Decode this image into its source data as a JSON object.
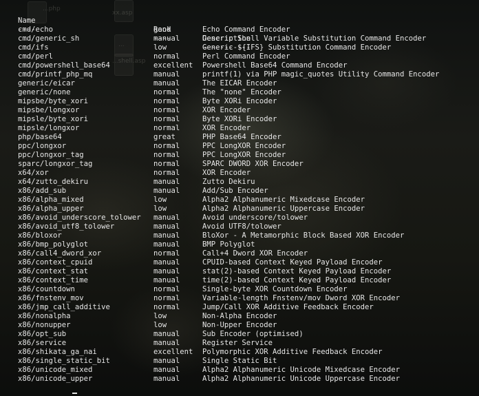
{
  "desktop": {
    "icon_labels": [
      "...php",
      "xx.asp",
      "...",
      "...shell.asp"
    ]
  },
  "terminal": {
    "header": {
      "name": "Name",
      "rank": "Rank",
      "description": "Description"
    },
    "separator": {
      "name": "----",
      "rank": "----",
      "description": "-----------"
    },
    "rows": [
      {
        "name": "cmd/echo",
        "rank": "good",
        "description": "Echo Command Encoder"
      },
      {
        "name": "cmd/generic_sh",
        "rank": "manual",
        "description": "Generic Shell Variable Substitution Command Encoder"
      },
      {
        "name": "cmd/ifs",
        "rank": "low",
        "description": "Generic ${IFS} Substitution Command Encoder"
      },
      {
        "name": "cmd/perl",
        "rank": "normal",
        "description": "Perl Command Encoder"
      },
      {
        "name": "cmd/powershell_base64",
        "rank": "excellent",
        "description": "Powershell Base64 Command Encoder"
      },
      {
        "name": "cmd/printf_php_mq",
        "rank": "manual",
        "description": "printf(1) via PHP magic_quotes Utility Command Encoder"
      },
      {
        "name": "generic/eicar",
        "rank": "manual",
        "description": "The EICAR Encoder"
      },
      {
        "name": "generic/none",
        "rank": "normal",
        "description": "The \"none\" Encoder"
      },
      {
        "name": "mipsbe/byte_xori",
        "rank": "normal",
        "description": "Byte XORi Encoder"
      },
      {
        "name": "mipsbe/longxor",
        "rank": "normal",
        "description": "XOR Encoder"
      },
      {
        "name": "mipsle/byte_xori",
        "rank": "normal",
        "description": "Byte XORi Encoder"
      },
      {
        "name": "mipsle/longxor",
        "rank": "normal",
        "description": "XOR Encoder"
      },
      {
        "name": "php/base64",
        "rank": "great",
        "description": "PHP Base64 Encoder"
      },
      {
        "name": "ppc/longxor",
        "rank": "normal",
        "description": "PPC LongXOR Encoder"
      },
      {
        "name": "ppc/longxor_tag",
        "rank": "normal",
        "description": "PPC LongXOR Encoder"
      },
      {
        "name": "sparc/longxor_tag",
        "rank": "normal",
        "description": "SPARC DWORD XOR Encoder"
      },
      {
        "name": "x64/xor",
        "rank": "normal",
        "description": "XOR Encoder"
      },
      {
        "name": "x64/zutto_dekiru",
        "rank": "manual",
        "description": "Zutto Dekiru"
      },
      {
        "name": "x86/add_sub",
        "rank": "manual",
        "description": "Add/Sub Encoder"
      },
      {
        "name": "x86/alpha_mixed",
        "rank": "low",
        "description": "Alpha2 Alphanumeric Mixedcase Encoder"
      },
      {
        "name": "x86/alpha_upper",
        "rank": "low",
        "description": "Alpha2 Alphanumeric Uppercase Encoder"
      },
      {
        "name": "x86/avoid_underscore_tolower",
        "rank": "manual",
        "description": "Avoid underscore/tolower"
      },
      {
        "name": "x86/avoid_utf8_tolower",
        "rank": "manual",
        "description": "Avoid UTF8/tolower"
      },
      {
        "name": "x86/bloxor",
        "rank": "manual",
        "description": "BloXor - A Metamorphic Block Based XOR Encoder"
      },
      {
        "name": "x86/bmp_polyglot",
        "rank": "manual",
        "description": "BMP Polyglot"
      },
      {
        "name": "x86/call4_dword_xor",
        "rank": "normal",
        "description": "Call+4 Dword XOR Encoder"
      },
      {
        "name": "x86/context_cpuid",
        "rank": "manual",
        "description": "CPUID-based Context Keyed Payload Encoder"
      },
      {
        "name": "x86/context_stat",
        "rank": "manual",
        "description": "stat(2)-based Context Keyed Payload Encoder"
      },
      {
        "name": "x86/context_time",
        "rank": "manual",
        "description": "time(2)-based Context Keyed Payload Encoder"
      },
      {
        "name": "x86/countdown",
        "rank": "normal",
        "description": "Single-byte XOR Countdown Encoder"
      },
      {
        "name": "x86/fnstenv_mov",
        "rank": "normal",
        "description": "Variable-length Fnstenv/mov Dword XOR Encoder"
      },
      {
        "name": "x86/jmp_call_additive",
        "rank": "normal",
        "description": "Jump/Call XOR Additive Feedback Encoder"
      },
      {
        "name": "x86/nonalpha",
        "rank": "low",
        "description": "Non-Alpha Encoder"
      },
      {
        "name": "x86/nonupper",
        "rank": "low",
        "description": "Non-Upper Encoder"
      },
      {
        "name": "x86/opt_sub",
        "rank": "manual",
        "description": "Sub Encoder (optimised)"
      },
      {
        "name": "x86/service",
        "rank": "manual",
        "description": "Register Service"
      },
      {
        "name": "x86/shikata_ga_nai",
        "rank": "excellent",
        "description": "Polymorphic XOR Additive Feedback Encoder"
      },
      {
        "name": "x86/single_static_bit",
        "rank": "manual",
        "description": "Single Static Bit"
      },
      {
        "name": "x86/unicode_mixed",
        "rank": "manual",
        "description": "Alpha2 Alphanumeric Unicode Mixedcase Encoder"
      },
      {
        "name": "x86/unicode_upper",
        "rank": "manual",
        "description": "Alpha2 Alphanumeric Unicode Uppercase Encoder"
      }
    ]
  }
}
